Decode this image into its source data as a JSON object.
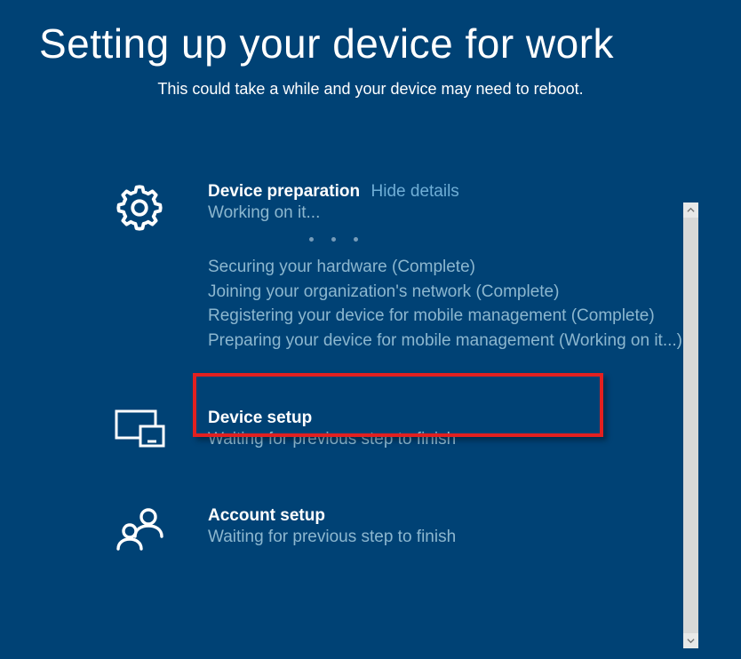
{
  "header": {
    "title": "Setting up your device for work",
    "subtitle": "This could take a while and your device may need to reboot."
  },
  "sections": {
    "preparation": {
      "heading": "Device preparation",
      "toggle_label": "Hide details",
      "status": "Working on it...",
      "details": [
        "Securing your hardware (Complete)",
        "Joining your organization's network (Complete)",
        "Registering your device for mobile management (Complete)",
        "Preparing your device for mobile management (Working on it...)"
      ]
    },
    "device_setup": {
      "heading": "Device setup",
      "status": "Waiting for previous step to finish"
    },
    "account_setup": {
      "heading": "Account setup",
      "status": "Waiting for previous step to finish"
    }
  }
}
